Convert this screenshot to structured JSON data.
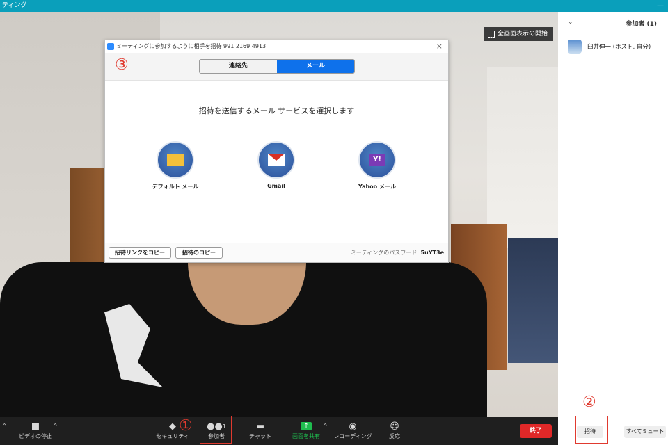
{
  "window": {
    "title": "ティング",
    "minimize": "—"
  },
  "video": {
    "fullscreen_label": "全画面表示の開始"
  },
  "dialog": {
    "title": "ミーティングに参加するように相手を招待 991 2169 4913",
    "close": "×",
    "tabs": [
      {
        "label": "連絡先",
        "active": false
      },
      {
        "label": "メール",
        "active": true
      }
    ],
    "heading": "招待を送信するメール サービスを選択します",
    "services": [
      {
        "label": "デフォルト メール",
        "icon": "default-mail-icon"
      },
      {
        "label": "Gmail",
        "icon": "gmail-icon"
      },
      {
        "label": "Yahoo メール",
        "icon": "yahoo-mail-icon",
        "glyph": "Y!"
      }
    ],
    "copy_link_label": "招待リンクをコピー",
    "copy_invite_label": "招待のコピー",
    "password_label": "ミーティングのパスワード:",
    "password_value": "5uYT3e"
  },
  "annotations": {
    "one": "①",
    "two": "②",
    "three": "③"
  },
  "toolbar": {
    "video_stop": "ビデオの停止",
    "security": "セキュリティ",
    "participants": "参加者",
    "participants_count": "1",
    "chat": "チャット",
    "share": "画面を共有",
    "record": "レコーディング",
    "reactions": "反応",
    "end": "終了"
  },
  "sidebar": {
    "title": "参加者 (1)",
    "participant_name": "臼井伸一 (ホスト, 自分)",
    "invite_label": "招待",
    "mute_all_label": "すべてミュート"
  },
  "colors": {
    "accent": "#0e71eb",
    "share_green": "#1fbd4f",
    "end_red": "#e02828",
    "annotation_red": "#e03a2f",
    "titlebar": "#0a9fbb"
  }
}
